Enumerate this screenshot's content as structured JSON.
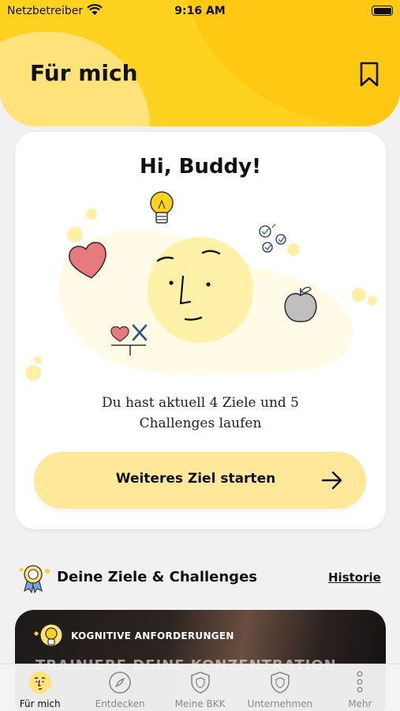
{
  "status_bar": {
    "carrier": "Netzbetreiber",
    "time": "9:16 AM"
  },
  "header": {
    "title": "Für mich",
    "bookmark_icon": "bookmark-icon"
  },
  "welcome_card": {
    "greeting": "Hi, Buddy!",
    "summary": "Du hast aktuell 4 Ziele und 5 Challenges laufen",
    "cta_label": "Weiteres Ziel starten"
  },
  "goals_section": {
    "title": "Deine Ziele & Challenges",
    "history_link": "Historie",
    "icon": "award-ribbon-icon"
  },
  "challenge_card": {
    "category": "KOGNITIVE ANFORDERUNGEN",
    "title_partial": "TRAINIERE DEINE KONZENTRATION",
    "icon": "lightbulb-icon"
  },
  "tab_bar": {
    "items": [
      {
        "label": "Für mich",
        "icon": "face-icon",
        "active": true
      },
      {
        "label": "Entdecken",
        "icon": "compass-icon",
        "active": false
      },
      {
        "label": "Meine BKK",
        "icon": "shield-icon",
        "active": false
      },
      {
        "label": "Unternehmen",
        "icon": "shield-icon",
        "active": false
      },
      {
        "label": "Mehr",
        "icon": "more-dots-icon",
        "active": false
      }
    ]
  },
  "colors": {
    "brand_yellow": "#ffd21f",
    "cta_yellow": "#ffe89a",
    "face_yellow": "#fff1a8"
  }
}
